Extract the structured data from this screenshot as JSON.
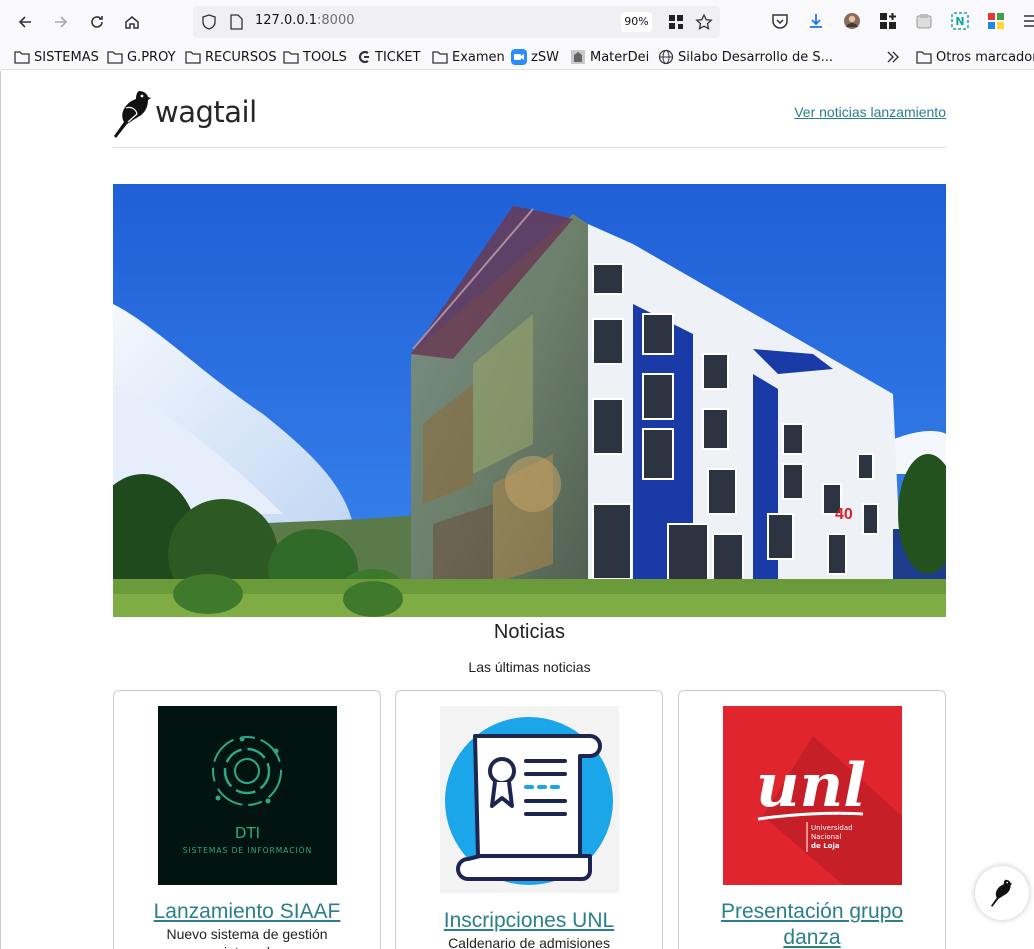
{
  "browser": {
    "url_host": "127.0.0.1",
    "url_port": ":8000",
    "zoom": "90%"
  },
  "bookmarks": [
    {
      "label": "SISTEMAS",
      "icon": "folder-icon"
    },
    {
      "label": "G.PROY",
      "icon": "folder-icon"
    },
    {
      "label": "RECURSOS",
      "icon": "folder-icon"
    },
    {
      "label": "TOOLS",
      "icon": "folder-icon"
    },
    {
      "label": "TICKET",
      "icon": "ticket-icon"
    },
    {
      "label": "Examen",
      "icon": "folder-icon"
    },
    {
      "label": "zSW",
      "icon": "zoom-icon"
    },
    {
      "label": "MaterDei",
      "icon": "site-icon"
    },
    {
      "label": "Silabo Desarrollo de S...",
      "icon": "globe-icon"
    },
    {
      "label": "Otros marcadores",
      "icon": "folder-icon"
    }
  ],
  "site": {
    "logo_text": "wagtail",
    "header_link": "Ver noticias lanzamiento"
  },
  "news": {
    "title": "Noticias",
    "subtitle": "Las últimas noticias",
    "cards": [
      {
        "title": "Lanzamiento SIAAF",
        "description": "Nuevo sistema de gestión integral",
        "image_caption": "DTI",
        "image_subcaption": "SISTEMAS DE INFORMACIÓN"
      },
      {
        "title": "Inscripciones UNL",
        "description": "Caldenario de admisiones"
      },
      {
        "title": "Presentación grupo danza",
        "description": "",
        "image_logo": "unl",
        "image_logo_line1": "Universidad",
        "image_logo_line2": "Nacional",
        "image_logo_line3": "de Loja"
      }
    ]
  },
  "hero": {
    "building_number": "40"
  },
  "colors": {
    "link": "#2b7f8a",
    "dti_bg": "#04201a",
    "dti_accent": "#2fa88a",
    "unl_red": "#e0252f"
  }
}
